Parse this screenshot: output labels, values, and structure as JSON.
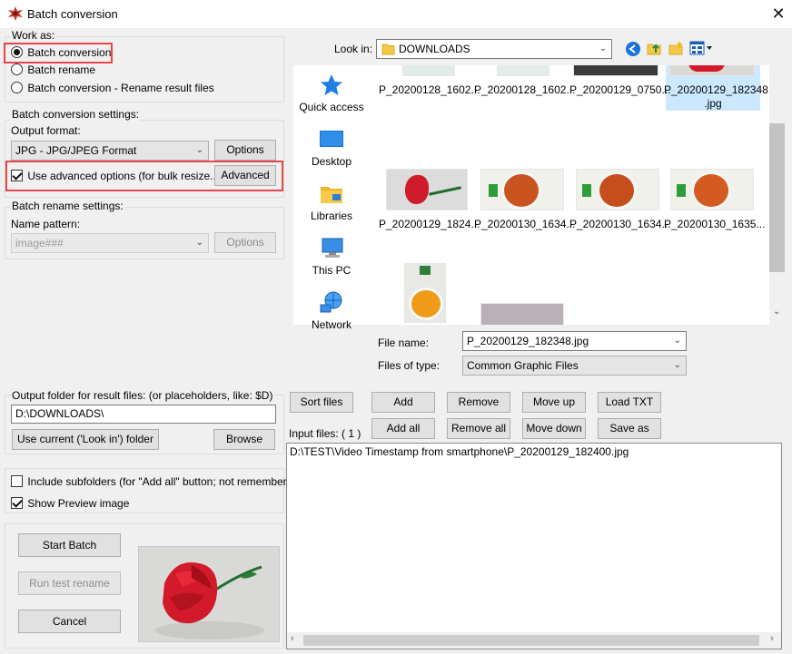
{
  "window": {
    "title": "Batch conversion",
    "close_glyph": "✕"
  },
  "work_as": {
    "label": "Work as:",
    "options": [
      "Batch conversion",
      "Batch rename",
      "Batch conversion - Rename result files"
    ],
    "selected": 0
  },
  "conversion": {
    "group_label": "Batch conversion settings:",
    "output_format_label": "Output format:",
    "output_format_value": "JPG - JPG/JPEG Format",
    "options_button": "Options",
    "advanced_checkbox": "Use advanced options (for bulk resize...)",
    "advanced_button": "Advanced"
  },
  "rename": {
    "group_label": "Batch rename settings:",
    "name_pattern_label": "Name pattern:",
    "name_pattern_value": "image###",
    "options_button": "Options"
  },
  "output_folder": {
    "label": "Output folder for result files: (or placeholders, like: $D)",
    "value": "D:\\DOWNLOADS\\",
    "use_current_button": "Use current ('Look in') folder",
    "browse_button": "Browse"
  },
  "checks": {
    "include_subfolders": "Include subfolders (for \"Add all\" button; not remembered)",
    "show_preview": "Show Preview image"
  },
  "actions": {
    "start": "Start Batch",
    "run_test": "Run test rename",
    "cancel": "Cancel"
  },
  "look_in": {
    "label": "Look in:",
    "value": "DOWNLOADS"
  },
  "nav": [
    "Quick access",
    "Desktop",
    "Libraries",
    "This PC",
    "Network"
  ],
  "files_row1": [
    "P_20200128_1602...",
    "P_20200128_1602...",
    "P_20200129_0750...",
    "P_20200129_182348",
    ".jpg"
  ],
  "files_row2": [
    "P_20200129_1824...",
    "P_20200130_1634...",
    "P_20200130_1634...",
    "P_20200130_1635..."
  ],
  "file_name": {
    "label": "File name:",
    "value": "P_20200129_182348.jpg"
  },
  "file_type": {
    "label": "Files of type:",
    "value": "Common Graphic Files"
  },
  "list_buttons": {
    "sort": "Sort files",
    "add": "Add",
    "remove": "Remove",
    "move_up": "Move up",
    "load_txt": "Load TXT",
    "add_all": "Add all",
    "remove_all": "Remove all",
    "move_down": "Move down",
    "save_txt": "Save as TXT"
  },
  "input_files": {
    "label": "Input files: ( 1 )",
    "items": [
      "D:\\TEST\\Video Timestamp  from smartphone\\P_20200129_182400.jpg"
    ]
  },
  "colors": {
    "highlight": "#e8474a",
    "selection": "#cce8ff",
    "accent": "#1a74d8"
  }
}
